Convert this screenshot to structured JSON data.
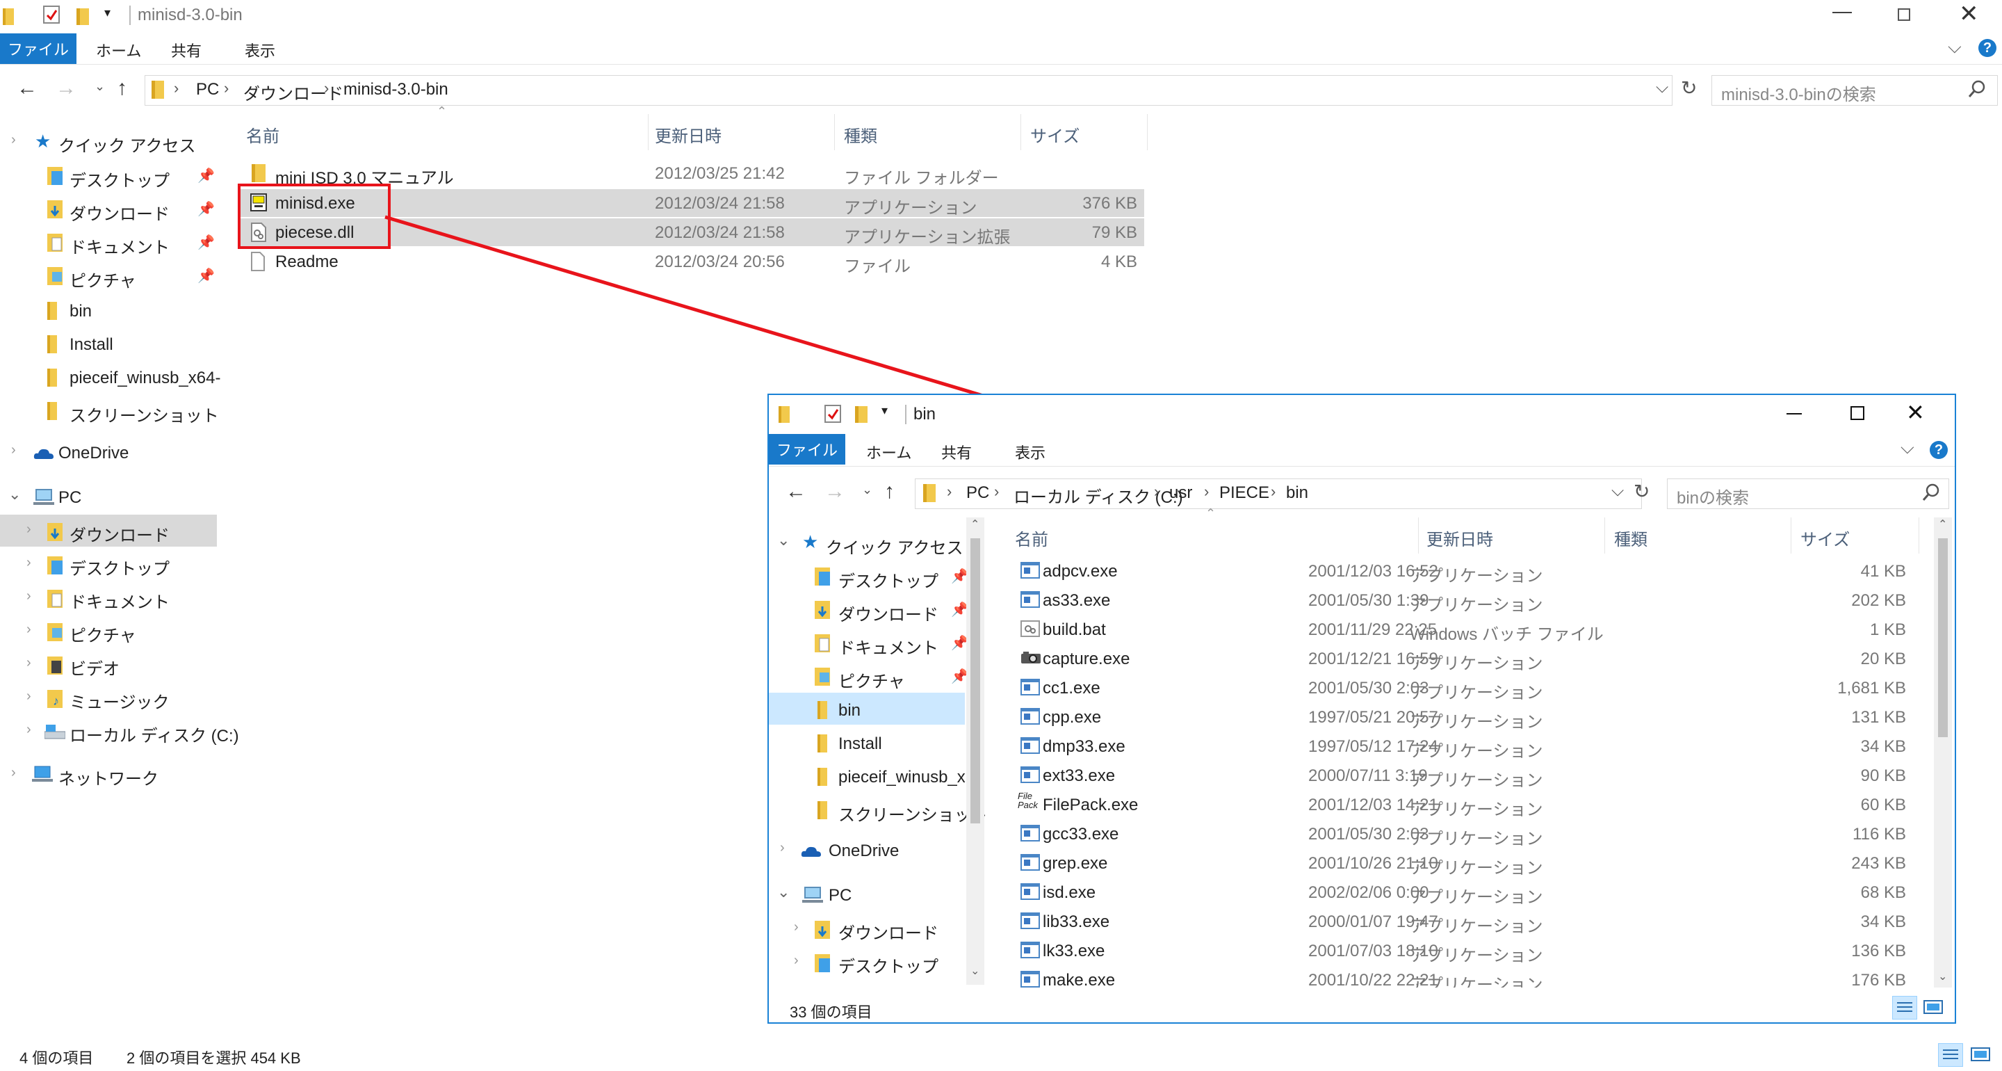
{
  "back_window": {
    "title": "minisd-3.0-bin",
    "ribbon": {
      "file": "ファイル",
      "home": "ホーム",
      "share": "共有",
      "view": "表示"
    },
    "address": {
      "root": "PC",
      "seg1": "ダウンロード",
      "seg2": "minisd-3.0-bin"
    },
    "search_placeholder": "minisd-3.0-binの検索",
    "columns": {
      "name": "名前",
      "date": "更新日時",
      "type": "種類",
      "size": "サイズ"
    },
    "files": [
      {
        "name": "mini ISD 3.0 マニュアル",
        "date": "2012/03/25 21:42",
        "type": "ファイル フォルダー",
        "size": ""
      },
      {
        "name": "minisd.exe",
        "date": "2012/03/24 21:58",
        "type": "アプリケーション",
        "size": "376 KB"
      },
      {
        "name": "piecese.dll",
        "date": "2012/03/24 21:58",
        "type": "アプリケーション拡張",
        "size": "79 KB"
      },
      {
        "name": "Readme",
        "date": "2012/03/24 20:56",
        "type": "ファイル",
        "size": "4 KB"
      }
    ],
    "nav": {
      "quick_access": "クイック アクセス",
      "quick_items": [
        "デスクトップ",
        "ダウンロード",
        "ドキュメント",
        "ピクチャ",
        "bin",
        "Install",
        "pieceif_winusb_x64-",
        "スクリーンショット"
      ],
      "onedrive": "OneDrive",
      "pc": "PC",
      "pc_items": [
        "ダウンロード",
        "デスクトップ",
        "ドキュメント",
        "ピクチャ",
        "ビデオ",
        "ミュージック",
        "ローカル ディスク (C:)"
      ],
      "network": "ネットワーク"
    },
    "status": {
      "count": "4 個の項目",
      "selected": "2 個の項目を選択  454 KB"
    }
  },
  "front_window": {
    "title": "bin",
    "ribbon": {
      "file": "ファイル",
      "home": "ホーム",
      "share": "共有",
      "view": "表示"
    },
    "address": {
      "root": "PC",
      "seg1": "ローカル ディスク (C:)",
      "seg2": "usr",
      "seg3": "PIECE",
      "seg4": "bin"
    },
    "search_placeholder": "binの検索",
    "columns": {
      "name": "名前",
      "date": "更新日時",
      "type": "種類",
      "size": "サイズ"
    },
    "files": [
      {
        "name": "adpcv.exe",
        "date": "2001/12/03 16:52",
        "type": "アプリケーション",
        "size": "41 KB",
        "icon": "exe"
      },
      {
        "name": "as33.exe",
        "date": "2001/05/30 1:39",
        "type": "アプリケーション",
        "size": "202 KB",
        "icon": "exe"
      },
      {
        "name": "build.bat",
        "date": "2001/11/29 22:25",
        "type": "Windows バッチ ファイル",
        "size": "1 KB",
        "icon": "bat"
      },
      {
        "name": "capture.exe",
        "date": "2001/12/21 16:59",
        "type": "アプリケーション",
        "size": "20 KB",
        "icon": "cam"
      },
      {
        "name": "cc1.exe",
        "date": "2001/05/30 2:03",
        "type": "アプリケーション",
        "size": "1,681 KB",
        "icon": "exe"
      },
      {
        "name": "cpp.exe",
        "date": "1997/05/21 20:57",
        "type": "アプリケーション",
        "size": "131 KB",
        "icon": "exe"
      },
      {
        "name": "dmp33.exe",
        "date": "1997/05/12 17:24",
        "type": "アプリケーション",
        "size": "34 KB",
        "icon": "exe"
      },
      {
        "name": "ext33.exe",
        "date": "2000/07/11 3:19",
        "type": "アプリケーション",
        "size": "90 KB",
        "icon": "exe"
      },
      {
        "name": "FilePack.exe",
        "date": "2001/12/03 14:21",
        "type": "アプリケーション",
        "size": "60 KB",
        "icon": "filepack"
      },
      {
        "name": "gcc33.exe",
        "date": "2001/05/30 2:03",
        "type": "アプリケーション",
        "size": "116 KB",
        "icon": "exe"
      },
      {
        "name": "grep.exe",
        "date": "2001/10/26 21:10",
        "type": "アプリケーション",
        "size": "243 KB",
        "icon": "exe"
      },
      {
        "name": "isd.exe",
        "date": "2002/02/06 0:00",
        "type": "アプリケーション",
        "size": "68 KB",
        "icon": "exe"
      },
      {
        "name": "lib33.exe",
        "date": "2000/01/07 19:47",
        "type": "アプリケーション",
        "size": "34 KB",
        "icon": "exe"
      },
      {
        "name": "lk33.exe",
        "date": "2001/07/03 18:10",
        "type": "アプリケーション",
        "size": "136 KB",
        "icon": "exe"
      },
      {
        "name": "make.exe",
        "date": "2001/10/22 22:21",
        "type": "アプリケーション",
        "size": "176 KB",
        "icon": "exe"
      }
    ],
    "filepack_icon_text": "File Pack",
    "nav": {
      "quick_access": "クイック アクセス",
      "quick_items": [
        "デスクトップ",
        "ダウンロード",
        "ドキュメント",
        "ピクチャ",
        "bin",
        "Install",
        "pieceif_winusb_x",
        "スクリーンショット"
      ],
      "onedrive": "OneDrive",
      "pc": "PC",
      "pc_items": [
        "ダウンロード",
        "デスクトップ"
      ]
    },
    "status": {
      "count": "33 個の項目"
    }
  },
  "colors": {
    "accent": "#1979ca",
    "selection": "#d9d9d9",
    "nav_selected": "#cce8ff",
    "annotation": "#e8141b"
  }
}
